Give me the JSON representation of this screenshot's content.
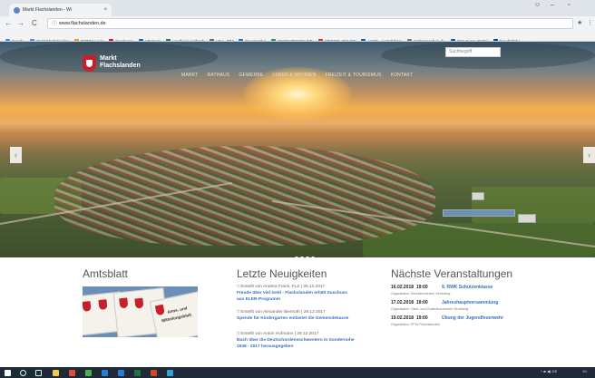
{
  "browser": {
    "tab_title": "Markt Flachslanden - Wi",
    "tab_close": "×",
    "url": "www.flachslanden.de",
    "window_minimize": "–",
    "window_maximize": "▫",
    "back": "←",
    "forward": "→",
    "reload": "C",
    "bookmarks": [
      {
        "label": "Google",
        "icon": "google-icon",
        "color": "#4285f4"
      },
      {
        "label": "Markt Flachslanden",
        "icon": "globe-icon",
        "color": "#5b85c7"
      },
      {
        "label": "TYPO3 Login",
        "icon": "typo3-icon",
        "color": "#f49700"
      },
      {
        "label": "Sparkasse",
        "icon": "sparkasse-icon",
        "color": "#e30613"
      },
      {
        "label": "VR-Bank",
        "icon": "vrbank-icon",
        "color": "#0066b3"
      },
      {
        "label": "Landkreis Ansbach",
        "icon": "crest-icon",
        "color": "#2c6e2f"
      },
      {
        "label": "LRA - RIM",
        "icon": "rim-icon",
        "color": "#666666"
      },
      {
        "label": "BayernAtlas",
        "icon": "bayern-icon",
        "color": "#0b74c4"
      },
      {
        "label": "GEODATENONLINE",
        "icon": "geo-icon",
        "color": "#2b8a3e"
      },
      {
        "label": "SPIEGEL ONLINE",
        "icon": "spiegel-icon",
        "color": "#e1261c"
      },
      {
        "label": "AKDB - Anstalt für K",
        "icon": "akdb-icon",
        "color": "#0e5aa7"
      },
      {
        "label": "Soldatenschule.de",
        "icon": "link-icon",
        "color": "#777777"
      },
      {
        "label": "SMA Sunny Portal",
        "icon": "sma-icon",
        "color": "#0055a5"
      },
      {
        "label": "Das Örtliche",
        "icon": "oertliche-icon",
        "color": "#003d7c"
      }
    ]
  },
  "site": {
    "logo_line1": "Markt",
    "logo_line2": "Flachslanden",
    "search_placeholder": "Suchbegriff",
    "nav": [
      "MARKT",
      "RATHAUS",
      "GEWERBE",
      "LEBEN & WOHNEN",
      "FREIZEIT & TOURISMUS",
      "KONTAKT"
    ],
    "slider_prev": "‹",
    "slider_next": "›",
    "slider_dots": 4,
    "slider_active": 1
  },
  "amtsblatt": {
    "title": "Amtsblatt",
    "flyer_text_1": "Amts- und",
    "flyer_text_2": "Mitteilungsblatt"
  },
  "news": {
    "title": "Letzte Neuigkeiten",
    "items": [
      {
        "meta": "Erstellt von Andrea Frank, FLZ | 30.12.2017",
        "title_line1": "Freude über viel Geld - Flachslanden erhält Zuschuss",
        "title_line2": "aus ELER-Programm"
      },
      {
        "meta": "Erstellt von Alexander Biernoth | 29.12.2017",
        "title_line1": "Spende für Kindergarten entlastet die Gemeindekasse",
        "title_line2": ""
      },
      {
        "meta": "Erstellt von Anton Hofmann | 28.12.2017",
        "title_line1": "Buch über die Deutschordensschwestern in Sondernohe",
        "title_line2": "1949 - 2017 herausgegeben"
      }
    ]
  },
  "events": {
    "title": "Nächste Veranstaltungen",
    "items": [
      {
        "date": "16.02.2018",
        "time": "19:00",
        "title": "9. RWK Schützenklasse",
        "organizer": "Organisator: Schützenverein Virnsberg"
      },
      {
        "date": "17.02.2018",
        "time": "19:00",
        "title": "Jahreshauptversammlung",
        "organizer": "Organisator: Obst- und Gartenbauverein Virnsberg"
      },
      {
        "date": "19.02.2018",
        "time": "19:00",
        "title": "Übung der Jugendfeuerwehr",
        "organizer": "Organisator: FFW Flachslanden"
      }
    ]
  },
  "taskbar": {
    "tray_text": "^ ▰ ◀) DE",
    "clock": "10:"
  }
}
